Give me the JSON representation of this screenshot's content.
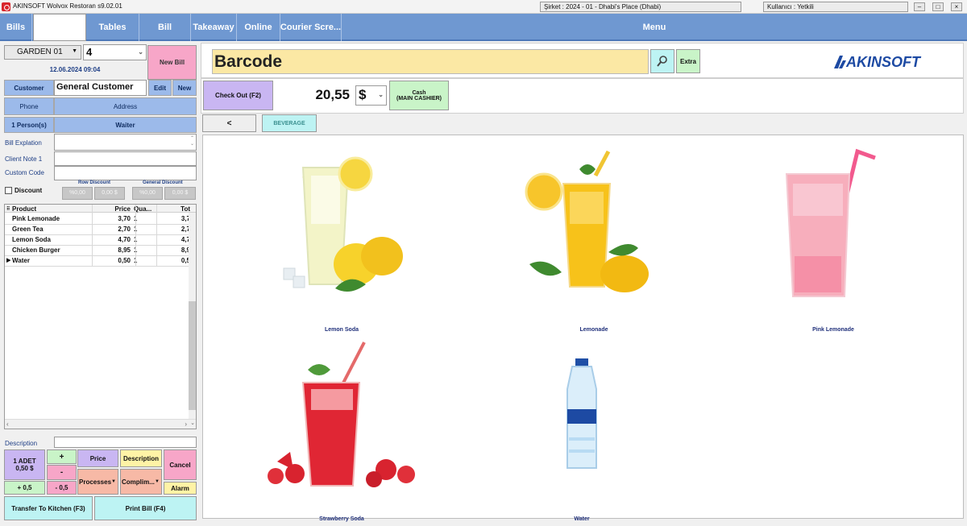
{
  "window": {
    "title": "AKINSOFT Wolvox Restoran s9.02.01",
    "company": "Şirket : 2024 - 01 - Dhabi's Place (Dhabi)",
    "user": "Kullanıcı : Yetkili",
    "min": "–",
    "max": "□",
    "close": "×"
  },
  "nav": {
    "items": [
      "Bills",
      "",
      "Tables",
      "Bill",
      "Takeaway",
      "Online",
      "Courier Scre...",
      "Menu"
    ]
  },
  "order": {
    "area": "GARDEN 01",
    "table_no": "4",
    "new_bill": "New Bill",
    "date": "12.06.2024 09:04"
  },
  "customer": {
    "label": "Customer",
    "value": "General Customer",
    "edit": "Edit",
    "new": "New",
    "phone": "Phone",
    "address": "Address",
    "persons": "1 Person(s)",
    "waiter": "Waiter"
  },
  "notes": {
    "bill_explanation": "Bill Explation",
    "client_note": "Client Note 1",
    "custom_code": "Custom Code"
  },
  "discount": {
    "label": "Discount",
    "row_discount": "Row Discount",
    "general_discount": "General Discount",
    "row_pct": "%0,00",
    "row_amt": "0,00 $",
    "gen_pct": "%0,00",
    "gen_amt": "0,00 $"
  },
  "table": {
    "headers": [
      "Product",
      "Price",
      "Qua...",
      "Tot"
    ],
    "rows": [
      [
        "Pink Lemonade",
        "3,70",
        "1",
        "3,7"
      ],
      [
        "Green Tea",
        "2,70",
        "1",
        "2,7"
      ],
      [
        "Lemon Soda",
        "4,70",
        "1",
        "4,7"
      ],
      [
        "Chicken Burger",
        "8,95",
        "1",
        "8,9"
      ],
      [
        "Water",
        "0,50",
        "1",
        "0,5"
      ]
    ]
  },
  "controls": {
    "description": "Description",
    "unit": "1 ADET",
    "unit_price": "0,50 $",
    "plus": "+",
    "minus": "-",
    "plus_half": "+ 0,5",
    "minus_half": "- 0,5",
    "price": "Price",
    "desc_btn": "Description",
    "cancel": "Cancel",
    "processes": "Processes",
    "compliment": "Complim...",
    "alarm": "Alarm",
    "transfer": "Transfer To Kitchen (F3)",
    "print": "Print Bill (F4)"
  },
  "barcode": {
    "placeholder": "Barcode",
    "extra": "Extra",
    "brand": "AKINSOFT"
  },
  "checkout": {
    "button": "Check Out (F2)",
    "total": "20,55",
    "currency": "$",
    "cash": "Cash",
    "cashier": "(MAIN CASHIER)"
  },
  "category": {
    "back": "<",
    "active": "BEVERAGE"
  },
  "products": [
    {
      "name": "Lemon Soda"
    },
    {
      "name": "Lemonade"
    },
    {
      "name": "Pink Lemonade"
    },
    {
      "name": "Strawberry Soda"
    },
    {
      "name": "Water"
    }
  ],
  "colors": {
    "nav": "#6f98d1",
    "blue_cell": "#9cbaea",
    "pink": "#f7a6c8",
    "green": "#c9f4c8",
    "cyan": "#bdf3f3",
    "lilac": "#c9b6f2",
    "yellow": "#fff3a6",
    "barcode_bg": "#fbe8a4"
  }
}
